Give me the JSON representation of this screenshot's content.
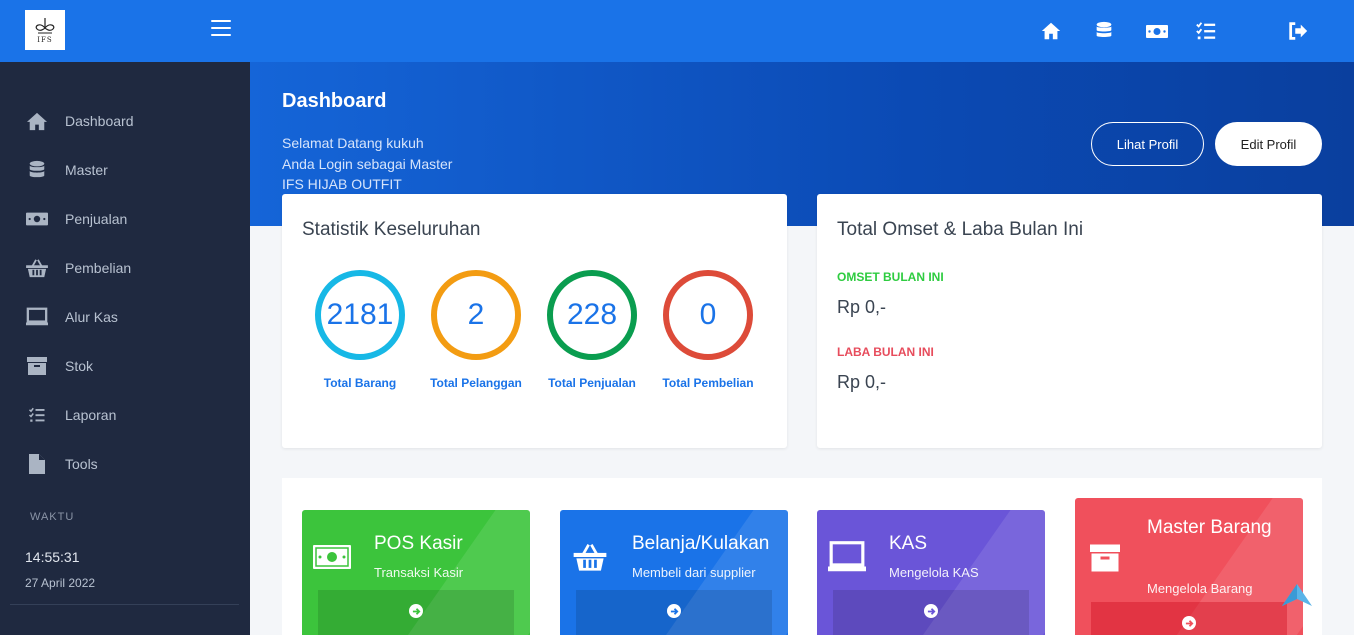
{
  "topbar": {
    "logo_text": "IFS",
    "menu_icon": "hamburger-menu-icon",
    "icons": [
      "home-icon",
      "database-icon",
      "money-icon",
      "list-check-icon",
      "logout-icon"
    ]
  },
  "sidebar": {
    "items": [
      {
        "label": "Dashboard",
        "icon": "home-icon"
      },
      {
        "label": "Master",
        "icon": "database-icon"
      },
      {
        "label": "Penjualan",
        "icon": "money-icon"
      },
      {
        "label": "Pembelian",
        "icon": "basket-icon"
      },
      {
        "label": "Alur Kas",
        "icon": "laptop-icon"
      },
      {
        "label": "Stok",
        "icon": "archive-icon"
      },
      {
        "label": "Laporan",
        "icon": "list-check-icon"
      },
      {
        "label": "Tools",
        "icon": "file-icon"
      }
    ],
    "waktu_label": "WAKTU",
    "clock": "14:55:31",
    "date": "27 April 2022"
  },
  "header": {
    "title": "Dashboard",
    "welcome_lines": [
      "Selamat Datang kukuh",
      "Anda Login sebagai Master",
      "IFS HIJAB OUTFIT"
    ],
    "lihat_profil": "Lihat Profil",
    "edit_profil": "Edit Profil"
  },
  "stats_card": {
    "title": "Statistik Keseluruhan",
    "stats": [
      {
        "value": "2181",
        "label": "Total Barang",
        "color": "#17b8e6"
      },
      {
        "value": "2",
        "label": "Total Pelanggan",
        "color": "#f39c12"
      },
      {
        "value": "228",
        "label": "Total Penjualan",
        "color": "#0a9d4f"
      },
      {
        "value": "0",
        "label": "Total Pembelian",
        "color": "#dd4b39"
      }
    ]
  },
  "omset_card": {
    "title": "Total Omset & Laba Bulan Ini",
    "omset_label": "OMSET BULAN INI",
    "omset_value": "Rp 0,-",
    "laba_label": "LABA BULAN INI",
    "laba_value": "Rp 0,-",
    "omset_color": "#2ecc40",
    "laba_color": "#e74c5c"
  },
  "tiles": [
    {
      "title": "POS Kasir",
      "sub": "Transaksi Kasir",
      "icon": "money-icon",
      "color": "#3cc43c"
    },
    {
      "title": "Belanja/Kulakan",
      "sub": "Membeli dari supplier",
      "icon": "basket-icon",
      "color": "#1a73e8"
    },
    {
      "title": "KAS",
      "sub": "Mengelola KAS",
      "icon": "laptop-icon",
      "color": "#6a55d8"
    },
    {
      "title": "Master Barang",
      "sub": "Mengelola Barang",
      "icon": "archive-icon",
      "color": "#f0505c"
    }
  ],
  "scroll_top_icon": "scroll-to-top-icon"
}
